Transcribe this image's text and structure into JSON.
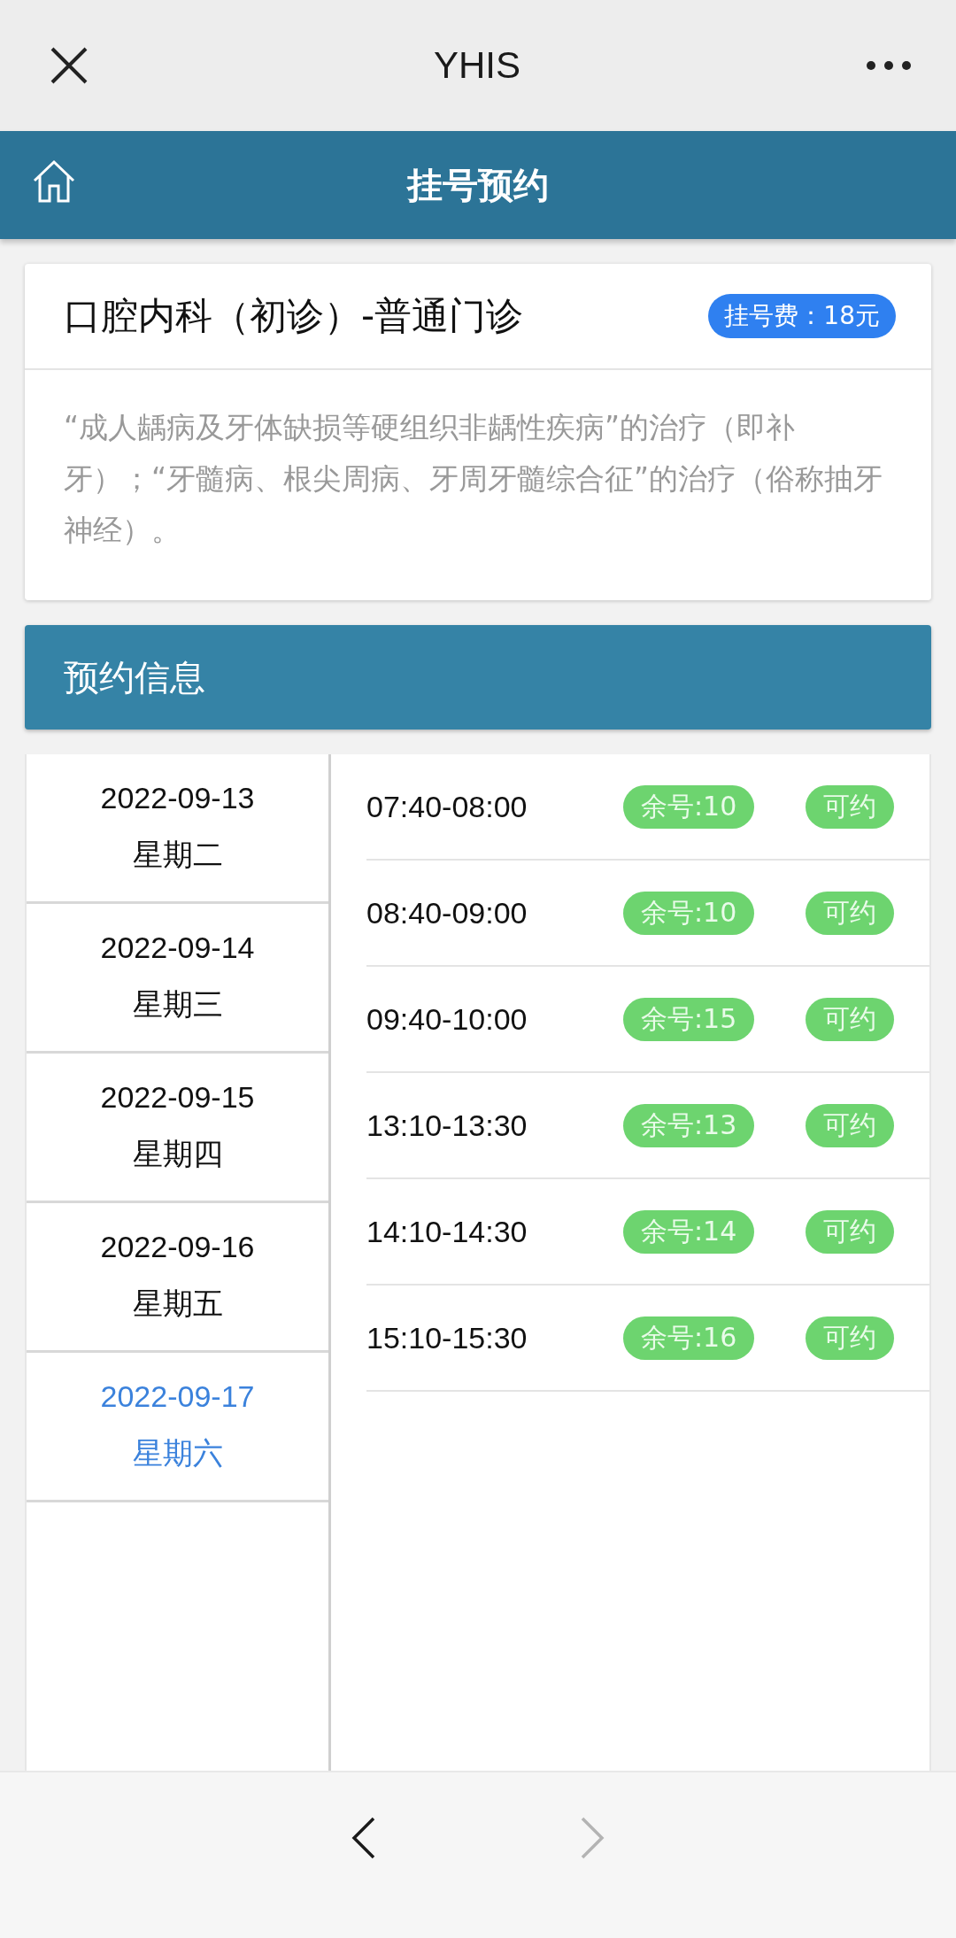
{
  "top_bar": {
    "title": "YHIS"
  },
  "header": {
    "title": "挂号预约"
  },
  "department": {
    "title": "口腔内科（初诊）-普通门诊",
    "fee": "挂号费：18元",
    "description": "“成人龋病及牙体缺损等硬组织非龋性疾病”的治疗（即补牙）；“牙髓病、根尖周病、牙周牙髓综合征”的治疗（俗称抽牙神经）。"
  },
  "section": {
    "title": "预约信息"
  },
  "dates": [
    {
      "date": "2022-09-13",
      "weekday": "星期二",
      "selected": false
    },
    {
      "date": "2022-09-14",
      "weekday": "星期三",
      "selected": false
    },
    {
      "date": "2022-09-15",
      "weekday": "星期四",
      "selected": false
    },
    {
      "date": "2022-09-16",
      "weekday": "星期五",
      "selected": false
    },
    {
      "date": "2022-09-17",
      "weekday": "星期六",
      "selected": true
    }
  ],
  "slots": [
    {
      "time": "07:40-08:00",
      "remaining": "余号:10",
      "status": "可约"
    },
    {
      "time": "08:40-09:00",
      "remaining": "余号:10",
      "status": "可约"
    },
    {
      "time": "09:40-10:00",
      "remaining": "余号:15",
      "status": "可约"
    },
    {
      "time": "13:10-13:30",
      "remaining": "余号:13",
      "status": "可约"
    },
    {
      "time": "14:10-14:30",
      "remaining": "余号:14",
      "status": "可约"
    },
    {
      "time": "15:10-15:30",
      "remaining": "余号:16",
      "status": "可约"
    }
  ],
  "browser_nav": {
    "back_disabled": false,
    "forward_disabled": true
  }
}
